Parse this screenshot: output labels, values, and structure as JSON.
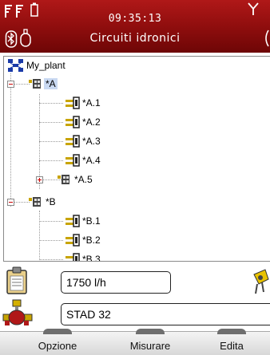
{
  "header": {
    "time": "09:35:13",
    "title": "Circuiti idronici"
  },
  "tree": {
    "root": "My_plant",
    "nodes": [
      {
        "label": "*A",
        "expander": "minus",
        "selected": true
      },
      {
        "label": "*A.1"
      },
      {
        "label": "*A.2"
      },
      {
        "label": "*A.3"
      },
      {
        "label": "*A.4"
      },
      {
        "label": "*A.5",
        "expander": "plus"
      },
      {
        "label": "*B",
        "expander": "minus"
      },
      {
        "label": "*B.1"
      },
      {
        "label": "*B.2"
      },
      {
        "label": "*B.3"
      }
    ]
  },
  "fields": {
    "flow": "1750 l/h",
    "valve": "STAD 32"
  },
  "footer": {
    "left": "Opzione",
    "center": "Misurare",
    "right": "Edita"
  },
  "colors": {
    "header": "#8c0d0d",
    "selection": "#c9d9f2",
    "expander_sign": "#cc0000"
  }
}
